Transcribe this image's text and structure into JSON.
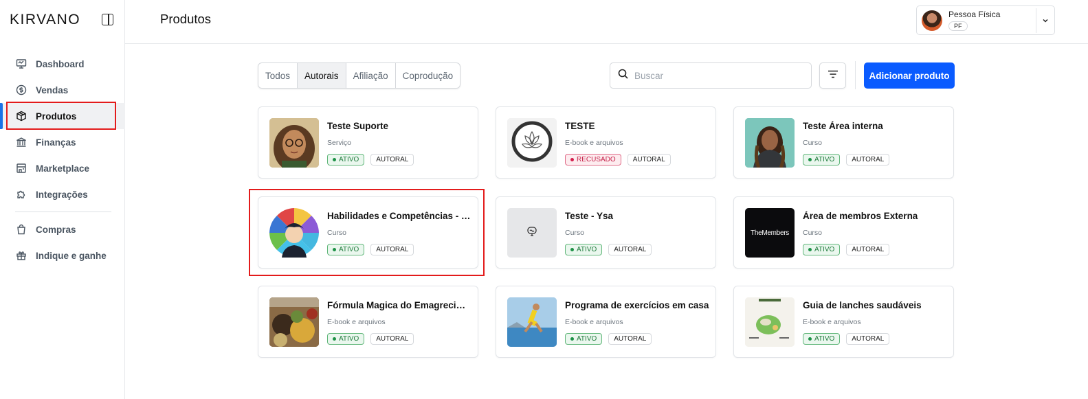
{
  "brand": {
    "logo": "KIRVANO"
  },
  "sidebar": {
    "items": [
      {
        "label": "Dashboard",
        "icon": "monitor-icon"
      },
      {
        "label": "Vendas",
        "icon": "dollar-circle-icon"
      },
      {
        "label": "Produtos",
        "icon": "box-icon",
        "active": true
      },
      {
        "label": "Finanças",
        "icon": "bank-icon"
      },
      {
        "label": "Marketplace",
        "icon": "store-icon"
      },
      {
        "label": "Integrações",
        "icon": "puzzle-icon"
      },
      {
        "label": "Compras",
        "icon": "shopping-bag-icon"
      },
      {
        "label": "Indique e ganhe",
        "icon": "gift-icon"
      }
    ]
  },
  "header": {
    "title": "Produtos",
    "account": {
      "name": "Pessoa Física",
      "badge": "PF"
    }
  },
  "toolbar": {
    "tabs": [
      "Todos",
      "Autorais",
      "Afiliação",
      "Coprodução"
    ],
    "active_tab": "Autorais",
    "search_placeholder": "Buscar",
    "add_label": "Adicionar produto"
  },
  "products": [
    {
      "title": "Teste Suporte",
      "type": "Serviço",
      "status": "ATIVO",
      "kind": "AUTORAL"
    },
    {
      "title": "TESTE",
      "type": "E-book e arquivos",
      "status": "RECUSADO",
      "kind": "AUTORAL"
    },
    {
      "title": "Teste Área interna",
      "type": "Curso",
      "status": "ATIVO",
      "kind": "AUTORAL"
    },
    {
      "title": "Habilidades e Competências - Y...",
      "type": "Curso",
      "status": "ATIVO",
      "kind": "AUTORAL"
    },
    {
      "title": "Teste - Ysa",
      "type": "Curso",
      "status": "ATIVO",
      "kind": "AUTORAL"
    },
    {
      "title": "Área de membros Externa",
      "type": "Curso",
      "status": "ATIVO",
      "kind": "AUTORAL",
      "thumb_text": "TheMembers"
    },
    {
      "title": "Fórmula Magica do Emagrecime...",
      "type": "E-book e arquivos",
      "status": "ATIVO",
      "kind": "AUTORAL"
    },
    {
      "title": "Programa de exercícios em casa",
      "type": "E-book e arquivos",
      "status": "ATIVO",
      "kind": "AUTORAL"
    },
    {
      "title": "Guia de lanches saudáveis",
      "type": "E-book e arquivos",
      "status": "ATIVO",
      "kind": "AUTORAL"
    }
  ],
  "colors": {
    "accent": "#0a5bff",
    "highlight": "#e31b1b",
    "active_green": "#1d7a3a",
    "refused_red": "#c51f48"
  }
}
